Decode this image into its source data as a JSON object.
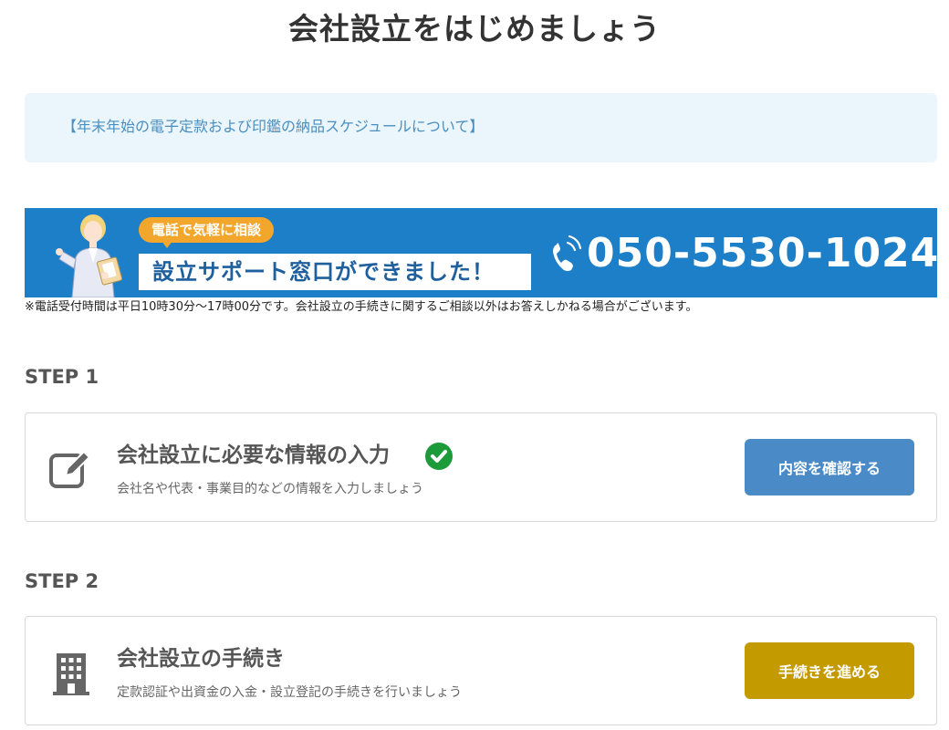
{
  "page": {
    "title": "会社設立をはじめましょう"
  },
  "notice": {
    "link_text": "【年末年始の電子定款および印鑑の納品スケジュールについて】"
  },
  "banner": {
    "bubble_text": "電話で気軽に相談",
    "headline": "設立サポート窓口ができました！",
    "phone_number": "050-5530-1024",
    "phone_note_mark": "※",
    "icons": [
      "person-illustration",
      "phone-icon"
    ],
    "colors": {
      "background": "#1e7fc9",
      "bubble": "#f2a62b"
    }
  },
  "hours_note": "※電話受付時間は平日10時30分～17時00分です。会社設立の手続きに関するご相談以外はお答えしかねる場合がございます。",
  "steps": [
    {
      "label": "STEP 1",
      "title": "会社設立に必要な情報の入力",
      "subtitle": "会社名や代表・事業目的などの情報を入力しましょう",
      "button_label": "内容を確認する",
      "button_color": "#4a8bc7",
      "icon": "edit-icon",
      "completed": true,
      "status_icon": "check-circle-icon"
    },
    {
      "label": "STEP 2",
      "title": "会社設立の手続き",
      "subtitle": "定款認証や出資金の入金・設立登記の手続きを行いましょう",
      "button_label": "手続きを進める",
      "button_color": "#c39a00",
      "icon": "building-icon",
      "completed": false
    }
  ]
}
